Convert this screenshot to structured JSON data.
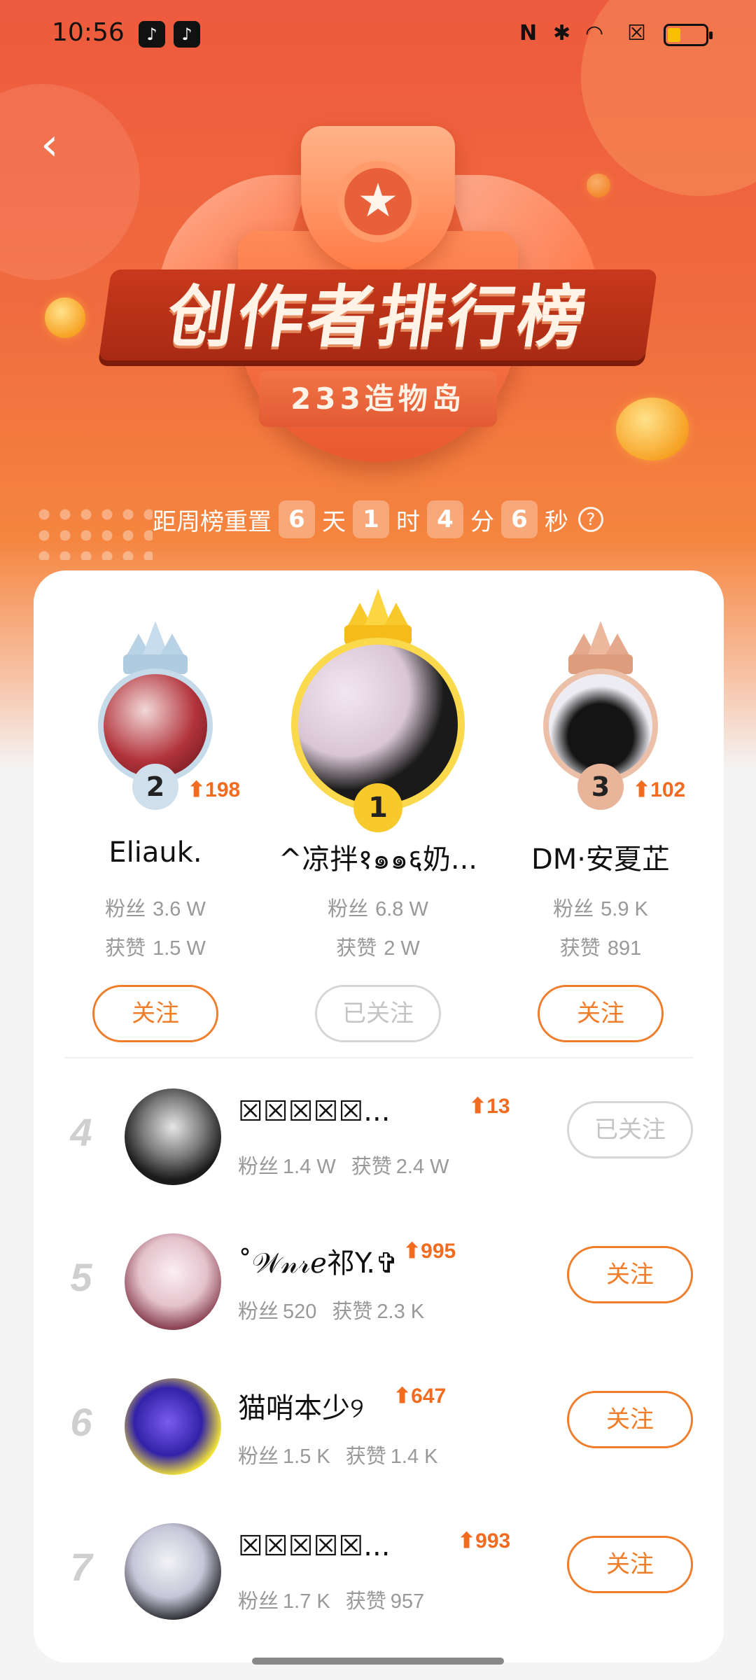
{
  "status_bar": {
    "time": "10:56",
    "app_icons": [
      "tiktok-icon",
      "tiktok-icon"
    ],
    "system_icons": [
      "nfc-icon",
      "bluetooth-icon",
      "wifi-icon",
      "no-sim-icon",
      "battery-icon"
    ],
    "battery_level": 0.35
  },
  "header": {
    "title": "创作者排行榜",
    "subtitle": "233造物岛"
  },
  "countdown": {
    "prefix": "距周榜重置",
    "days": "6",
    "days_unit": "天",
    "hours": "1",
    "hours_unit": "时",
    "minutes": "4",
    "minutes_unit": "分",
    "seconds": "6",
    "seconds_unit": "秒",
    "help_icon": "?"
  },
  "labels": {
    "fans": "粉丝",
    "likes": "获赞",
    "follow": "关注",
    "followed": "已关注"
  },
  "podium": [
    {
      "rank": "2",
      "name": "Eliauk.",
      "rise": "198",
      "fans": "3.6 W",
      "likes": "1.5 W",
      "button": "关注"
    },
    {
      "rank": "1",
      "name": "^凉拌१๑๑६奶...",
      "rise": "",
      "fans": "6.8 W",
      "likes": "2 W",
      "button": "已关注"
    },
    {
      "rank": "3",
      "name": "DM·安夏芷",
      "rise": "102",
      "fans": "5.9 K",
      "likes": "891",
      "button": "关注"
    }
  ],
  "list": [
    {
      "rank": "4",
      "name": "☒☒☒☒☒...",
      "rise": "13",
      "fans": "1.4 W",
      "likes": "2.4 W",
      "button": "已关注"
    },
    {
      "rank": "5",
      "name": "˚𝒲𝓃𝓇ℯ祁Y.✞",
      "rise": "995",
      "fans": "520",
      "likes": "2.3 K",
      "button": "关注"
    },
    {
      "rank": "6",
      "name": "猫哨本少୨",
      "rise": "647",
      "fans": "1.5 K",
      "likes": "1.4 K",
      "button": "关注"
    },
    {
      "rank": "7",
      "name": "☒☒☒☒☒...",
      "rise": "993",
      "fans": "1.7 K",
      "likes": "957",
      "button": "关注"
    }
  ],
  "colors": {
    "accent": "#f07d2a",
    "hero_top": "#ee5a3e",
    "gold": "#f8c92a",
    "silver": "#b9d3e6",
    "bronze": "#e4a98c"
  }
}
